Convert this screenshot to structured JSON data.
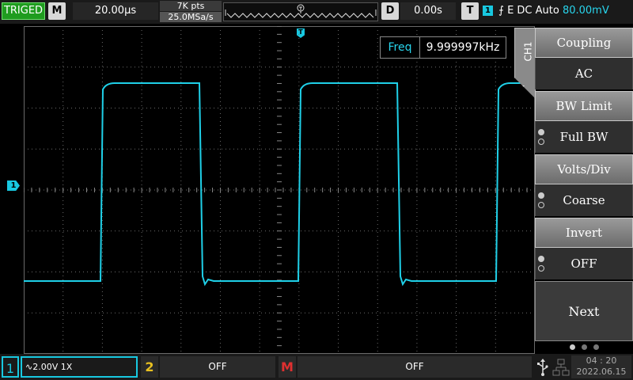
{
  "topbar": {
    "trigger_status": "TRIGED",
    "horizontal_key": "M",
    "timebase": "20.00μs",
    "memory_depth": "7K pts",
    "sample_rate": "25.0MSa/s",
    "delay_key": "D",
    "delay_value": "0.00s",
    "trigger_key": "T",
    "trigger_channel": "1",
    "trigger_slope_symbol": "⨍",
    "trigger_info": "E DC Auto",
    "trigger_level": "80.00mV"
  },
  "screen": {
    "freq_label": "Freq",
    "freq_value": "9.999997kHz",
    "ch1_marker": "1",
    "trigger_position_marker": "T",
    "waveform": {
      "type": "square",
      "color": "#1fd0e8",
      "levels": [
        "low",
        "high"
      ],
      "frequency": "9.999997kHz"
    }
  },
  "menu": {
    "channel_tab": "CH1",
    "items": [
      {
        "title": "Coupling",
        "value": "AC"
      },
      {
        "title": "BW Limit",
        "value": "Full BW"
      },
      {
        "title": "Volts/Div",
        "value": "Coarse"
      },
      {
        "title": "Invert",
        "value": "OFF"
      }
    ],
    "next_label": "Next"
  },
  "bottombar": {
    "ch1_number": "1",
    "ch1_settings": "2.00V 1X",
    "ch2_number": "2",
    "ch2_settings": "OFF",
    "math_label": "M",
    "math_settings": "OFF",
    "time": "04 : 20",
    "date": "2022.06.15"
  },
  "colors": {
    "ch1": "#18c8e0",
    "ch2": "#e8c020",
    "math": "#e03030",
    "triged": "#1f9c1f"
  }
}
